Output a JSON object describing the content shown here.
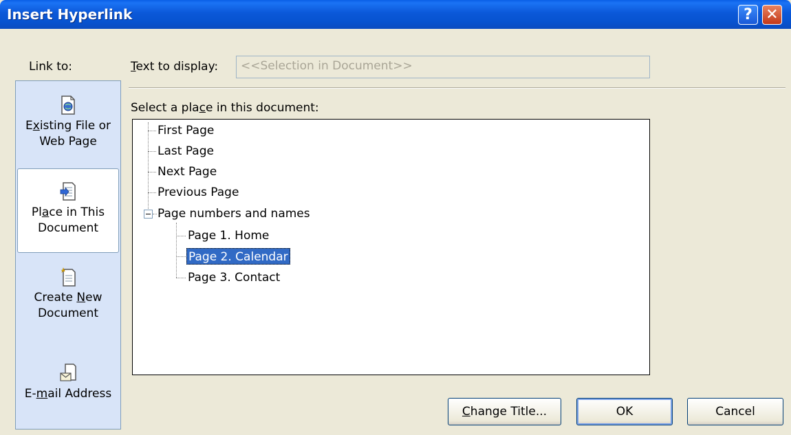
{
  "window": {
    "title": "Insert Hyperlink",
    "help_label": "?",
    "close_label": "✕"
  },
  "link_to": {
    "label": "Link to:",
    "items": [
      {
        "line1": "Existing File or",
        "line2": "Web Page",
        "icon": "existing-file-icon"
      },
      {
        "line1": "Place in This",
        "line2": "Document",
        "icon": "place-in-document-icon",
        "selected": true
      },
      {
        "line1": "Create New",
        "line2": "Document",
        "icon": "create-new-document-icon"
      },
      {
        "line1": "E-mail Address",
        "line2": "",
        "icon": "email-address-icon"
      }
    ]
  },
  "text_to_display": {
    "label": "Text to display:",
    "value": "<<Selection in Document>>"
  },
  "place_list": {
    "label": "Select a place in this document:",
    "items": [
      {
        "label": "First Page"
      },
      {
        "label": "Last Page"
      },
      {
        "label": "Next Page"
      },
      {
        "label": "Previous Page"
      },
      {
        "label": "Page numbers and names",
        "expanded": true,
        "children": [
          {
            "label": "Page 1. Home"
          },
          {
            "label": "Page 2. Calendar",
            "selected": true
          },
          {
            "label": "Page 3. Contact"
          }
        ]
      }
    ]
  },
  "buttons": {
    "change_title": "Change Title...",
    "ok": "OK",
    "cancel": "Cancel"
  },
  "colors": {
    "title_bar": "#0a58d8",
    "selection": "#316ac5",
    "dialog_bg": "#ece9d8",
    "link_bar_bg": "#d8e4f8"
  }
}
